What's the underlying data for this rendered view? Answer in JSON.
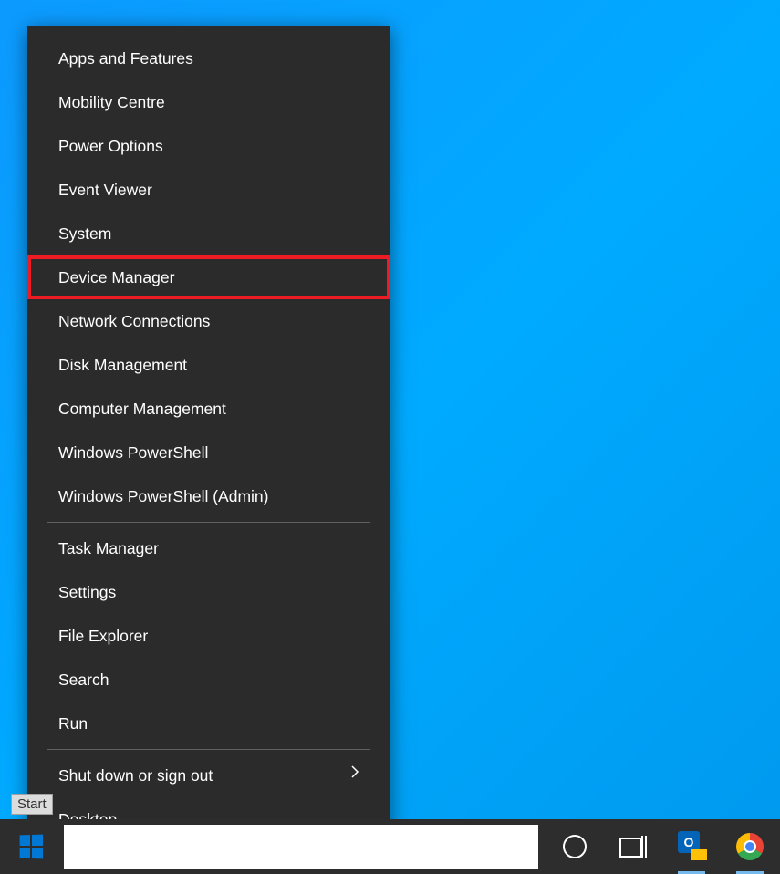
{
  "tooltip": "Start",
  "menu": {
    "group1": [
      {
        "label": "Apps and Features",
        "highlighted": false
      },
      {
        "label": "Mobility Centre",
        "highlighted": false
      },
      {
        "label": "Power Options",
        "highlighted": false
      },
      {
        "label": "Event Viewer",
        "highlighted": false
      },
      {
        "label": "System",
        "highlighted": false
      },
      {
        "label": "Device Manager",
        "highlighted": true
      },
      {
        "label": "Network Connections",
        "highlighted": false
      },
      {
        "label": "Disk Management",
        "highlighted": false
      },
      {
        "label": "Computer Management",
        "highlighted": false
      },
      {
        "label": "Windows PowerShell",
        "highlighted": false
      },
      {
        "label": "Windows PowerShell (Admin)",
        "highlighted": false
      }
    ],
    "group2": [
      {
        "label": "Task Manager"
      },
      {
        "label": "Settings"
      },
      {
        "label": "File Explorer"
      },
      {
        "label": "Search"
      },
      {
        "label": "Run"
      }
    ],
    "group3": [
      {
        "label": "Shut down or sign out",
        "submenu": true
      },
      {
        "label": "Desktop"
      }
    ]
  },
  "taskbar": {
    "outlook_letter": "O"
  }
}
